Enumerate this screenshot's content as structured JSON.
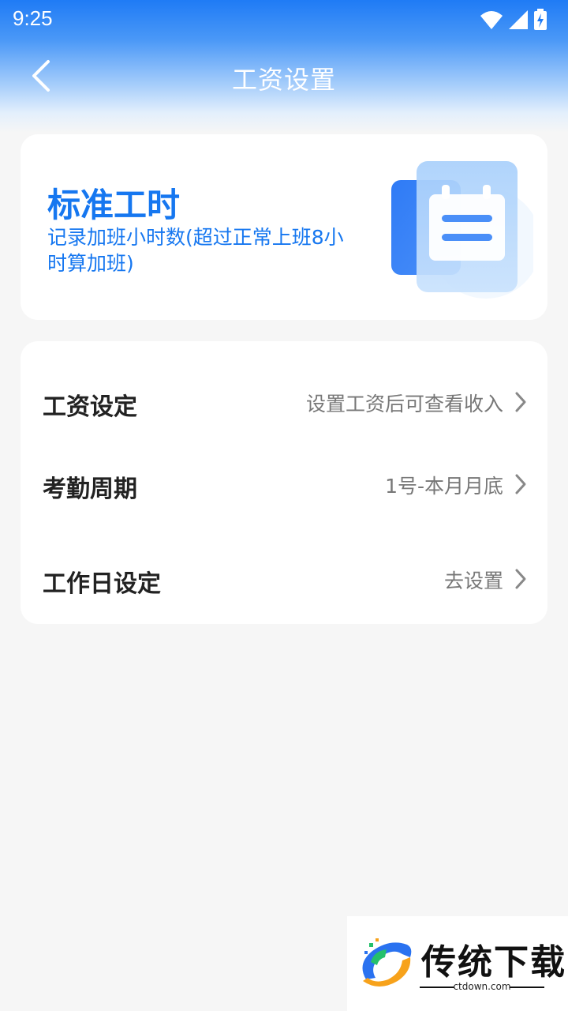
{
  "status_bar": {
    "time": "9:25",
    "icons": [
      "wifi-icon",
      "signal-icon",
      "battery-charging-icon"
    ]
  },
  "nav": {
    "back_icon": "chevron-left-icon",
    "title": "工资设置"
  },
  "banner": {
    "title": "标准工时",
    "description": "记录加班小时数(超过正常上班8小时算加班)",
    "illustration": "clipboard-document-icon",
    "accent_color": "#1677f0"
  },
  "settings": {
    "rows": [
      {
        "label": "工资设定",
        "value": "设置工资后可查看收入"
      },
      {
        "label": "考勤周期",
        "value": "1号-本月月底"
      },
      {
        "label": "工作日设定",
        "value": "去设置"
      }
    ]
  },
  "watermark": {
    "brand": "传统下载",
    "site": "ctdown.com"
  },
  "colors": {
    "header_gradient_top": "#1f7bf5",
    "page_background": "#f6f6f6",
    "card_background": "#ffffff"
  }
}
